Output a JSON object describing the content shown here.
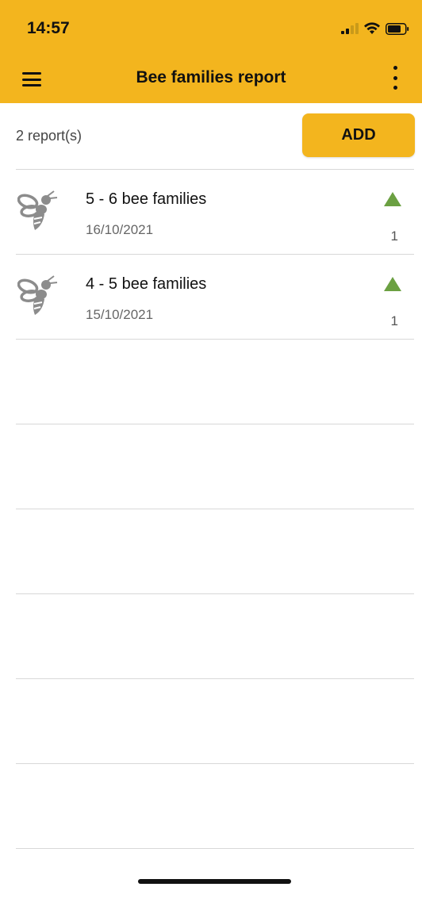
{
  "status_bar": {
    "time": "14:57",
    "icons": [
      "signal-icon",
      "wifi-icon",
      "battery-icon"
    ]
  },
  "header": {
    "title": "Bee families report",
    "menu_icon": "hamburger-menu-icon",
    "more_icon": "more-vertical-icon"
  },
  "toolbar": {
    "count_text": "2 report(s)",
    "add_label": "ADD"
  },
  "reports": [
    {
      "title": "5 - 6 bee families",
      "date": "16/10/2021",
      "trend": "up",
      "count": "1"
    },
    {
      "title": "4 - 5 bee families",
      "date": "15/10/2021",
      "trend": "up",
      "count": "1"
    }
  ],
  "colors": {
    "accent": "#F3B51E",
    "trend_up": "#6BA042",
    "icon_gray": "#8c8c8c",
    "divider": "#d8d8d8"
  }
}
